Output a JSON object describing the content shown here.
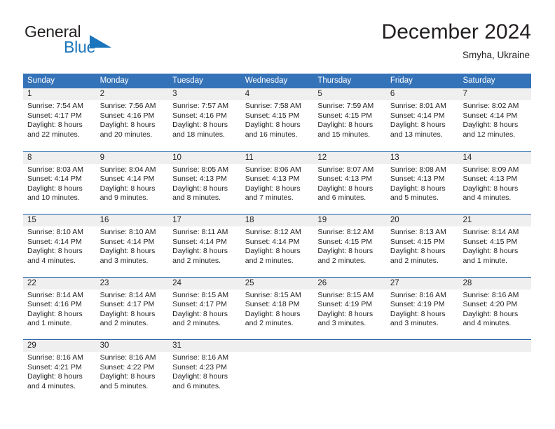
{
  "brand": {
    "name_part1": "General",
    "name_part2": "Blue",
    "triangle_color": "#1b75bc"
  },
  "header": {
    "title": "December 2024",
    "location": "Smyha, Ukraine"
  },
  "calendar": {
    "accent_color": "#3573b9",
    "weekdays": [
      "Sunday",
      "Monday",
      "Tuesday",
      "Wednesday",
      "Thursday",
      "Friday",
      "Saturday"
    ],
    "weeks": [
      {
        "days": [
          {
            "num": "1",
            "sunrise": "Sunrise: 7:54 AM",
            "sunset": "Sunset: 4:17 PM",
            "daylight_line1": "Daylight: 8 hours",
            "daylight_line2": "and 22 minutes."
          },
          {
            "num": "2",
            "sunrise": "Sunrise: 7:56 AM",
            "sunset": "Sunset: 4:16 PM",
            "daylight_line1": "Daylight: 8 hours",
            "daylight_line2": "and 20 minutes."
          },
          {
            "num": "3",
            "sunrise": "Sunrise: 7:57 AM",
            "sunset": "Sunset: 4:16 PM",
            "daylight_line1": "Daylight: 8 hours",
            "daylight_line2": "and 18 minutes."
          },
          {
            "num": "4",
            "sunrise": "Sunrise: 7:58 AM",
            "sunset": "Sunset: 4:15 PM",
            "daylight_line1": "Daylight: 8 hours",
            "daylight_line2": "and 16 minutes."
          },
          {
            "num": "5",
            "sunrise": "Sunrise: 7:59 AM",
            "sunset": "Sunset: 4:15 PM",
            "daylight_line1": "Daylight: 8 hours",
            "daylight_line2": "and 15 minutes."
          },
          {
            "num": "6",
            "sunrise": "Sunrise: 8:01 AM",
            "sunset": "Sunset: 4:14 PM",
            "daylight_line1": "Daylight: 8 hours",
            "daylight_line2": "and 13 minutes."
          },
          {
            "num": "7",
            "sunrise": "Sunrise: 8:02 AM",
            "sunset": "Sunset: 4:14 PM",
            "daylight_line1": "Daylight: 8 hours",
            "daylight_line2": "and 12 minutes."
          }
        ]
      },
      {
        "days": [
          {
            "num": "8",
            "sunrise": "Sunrise: 8:03 AM",
            "sunset": "Sunset: 4:14 PM",
            "daylight_line1": "Daylight: 8 hours",
            "daylight_line2": "and 10 minutes."
          },
          {
            "num": "9",
            "sunrise": "Sunrise: 8:04 AM",
            "sunset": "Sunset: 4:14 PM",
            "daylight_line1": "Daylight: 8 hours",
            "daylight_line2": "and 9 minutes."
          },
          {
            "num": "10",
            "sunrise": "Sunrise: 8:05 AM",
            "sunset": "Sunset: 4:13 PM",
            "daylight_line1": "Daylight: 8 hours",
            "daylight_line2": "and 8 minutes."
          },
          {
            "num": "11",
            "sunrise": "Sunrise: 8:06 AM",
            "sunset": "Sunset: 4:13 PM",
            "daylight_line1": "Daylight: 8 hours",
            "daylight_line2": "and 7 minutes."
          },
          {
            "num": "12",
            "sunrise": "Sunrise: 8:07 AM",
            "sunset": "Sunset: 4:13 PM",
            "daylight_line1": "Daylight: 8 hours",
            "daylight_line2": "and 6 minutes."
          },
          {
            "num": "13",
            "sunrise": "Sunrise: 8:08 AM",
            "sunset": "Sunset: 4:13 PM",
            "daylight_line1": "Daylight: 8 hours",
            "daylight_line2": "and 5 minutes."
          },
          {
            "num": "14",
            "sunrise": "Sunrise: 8:09 AM",
            "sunset": "Sunset: 4:13 PM",
            "daylight_line1": "Daylight: 8 hours",
            "daylight_line2": "and 4 minutes."
          }
        ]
      },
      {
        "days": [
          {
            "num": "15",
            "sunrise": "Sunrise: 8:10 AM",
            "sunset": "Sunset: 4:14 PM",
            "daylight_line1": "Daylight: 8 hours",
            "daylight_line2": "and 4 minutes."
          },
          {
            "num": "16",
            "sunrise": "Sunrise: 8:10 AM",
            "sunset": "Sunset: 4:14 PM",
            "daylight_line1": "Daylight: 8 hours",
            "daylight_line2": "and 3 minutes."
          },
          {
            "num": "17",
            "sunrise": "Sunrise: 8:11 AM",
            "sunset": "Sunset: 4:14 PM",
            "daylight_line1": "Daylight: 8 hours",
            "daylight_line2": "and 2 minutes."
          },
          {
            "num": "18",
            "sunrise": "Sunrise: 8:12 AM",
            "sunset": "Sunset: 4:14 PM",
            "daylight_line1": "Daylight: 8 hours",
            "daylight_line2": "and 2 minutes."
          },
          {
            "num": "19",
            "sunrise": "Sunrise: 8:12 AM",
            "sunset": "Sunset: 4:15 PM",
            "daylight_line1": "Daylight: 8 hours",
            "daylight_line2": "and 2 minutes."
          },
          {
            "num": "20",
            "sunrise": "Sunrise: 8:13 AM",
            "sunset": "Sunset: 4:15 PM",
            "daylight_line1": "Daylight: 8 hours",
            "daylight_line2": "and 2 minutes."
          },
          {
            "num": "21",
            "sunrise": "Sunrise: 8:14 AM",
            "sunset": "Sunset: 4:15 PM",
            "daylight_line1": "Daylight: 8 hours",
            "daylight_line2": "and 1 minute."
          }
        ]
      },
      {
        "days": [
          {
            "num": "22",
            "sunrise": "Sunrise: 8:14 AM",
            "sunset": "Sunset: 4:16 PM",
            "daylight_line1": "Daylight: 8 hours",
            "daylight_line2": "and 1 minute."
          },
          {
            "num": "23",
            "sunrise": "Sunrise: 8:14 AM",
            "sunset": "Sunset: 4:17 PM",
            "daylight_line1": "Daylight: 8 hours",
            "daylight_line2": "and 2 minutes."
          },
          {
            "num": "24",
            "sunrise": "Sunrise: 8:15 AM",
            "sunset": "Sunset: 4:17 PM",
            "daylight_line1": "Daylight: 8 hours",
            "daylight_line2": "and 2 minutes."
          },
          {
            "num": "25",
            "sunrise": "Sunrise: 8:15 AM",
            "sunset": "Sunset: 4:18 PM",
            "daylight_line1": "Daylight: 8 hours",
            "daylight_line2": "and 2 minutes."
          },
          {
            "num": "26",
            "sunrise": "Sunrise: 8:15 AM",
            "sunset": "Sunset: 4:19 PM",
            "daylight_line1": "Daylight: 8 hours",
            "daylight_line2": "and 3 minutes."
          },
          {
            "num": "27",
            "sunrise": "Sunrise: 8:16 AM",
            "sunset": "Sunset: 4:19 PM",
            "daylight_line1": "Daylight: 8 hours",
            "daylight_line2": "and 3 minutes."
          },
          {
            "num": "28",
            "sunrise": "Sunrise: 8:16 AM",
            "sunset": "Sunset: 4:20 PM",
            "daylight_line1": "Daylight: 8 hours",
            "daylight_line2": "and 4 minutes."
          }
        ]
      },
      {
        "days": [
          {
            "num": "29",
            "sunrise": "Sunrise: 8:16 AM",
            "sunset": "Sunset: 4:21 PM",
            "daylight_line1": "Daylight: 8 hours",
            "daylight_line2": "and 4 minutes."
          },
          {
            "num": "30",
            "sunrise": "Sunrise: 8:16 AM",
            "sunset": "Sunset: 4:22 PM",
            "daylight_line1": "Daylight: 8 hours",
            "daylight_line2": "and 5 minutes."
          },
          {
            "num": "31",
            "sunrise": "Sunrise: 8:16 AM",
            "sunset": "Sunset: 4:23 PM",
            "daylight_line1": "Daylight: 8 hours",
            "daylight_line2": "and 6 minutes."
          },
          {
            "num": "",
            "sunrise": "",
            "sunset": "",
            "daylight_line1": "",
            "daylight_line2": ""
          },
          {
            "num": "",
            "sunrise": "",
            "sunset": "",
            "daylight_line1": "",
            "daylight_line2": ""
          },
          {
            "num": "",
            "sunrise": "",
            "sunset": "",
            "daylight_line1": "",
            "daylight_line2": ""
          },
          {
            "num": "",
            "sunrise": "",
            "sunset": "",
            "daylight_line1": "",
            "daylight_line2": ""
          }
        ]
      }
    ]
  }
}
